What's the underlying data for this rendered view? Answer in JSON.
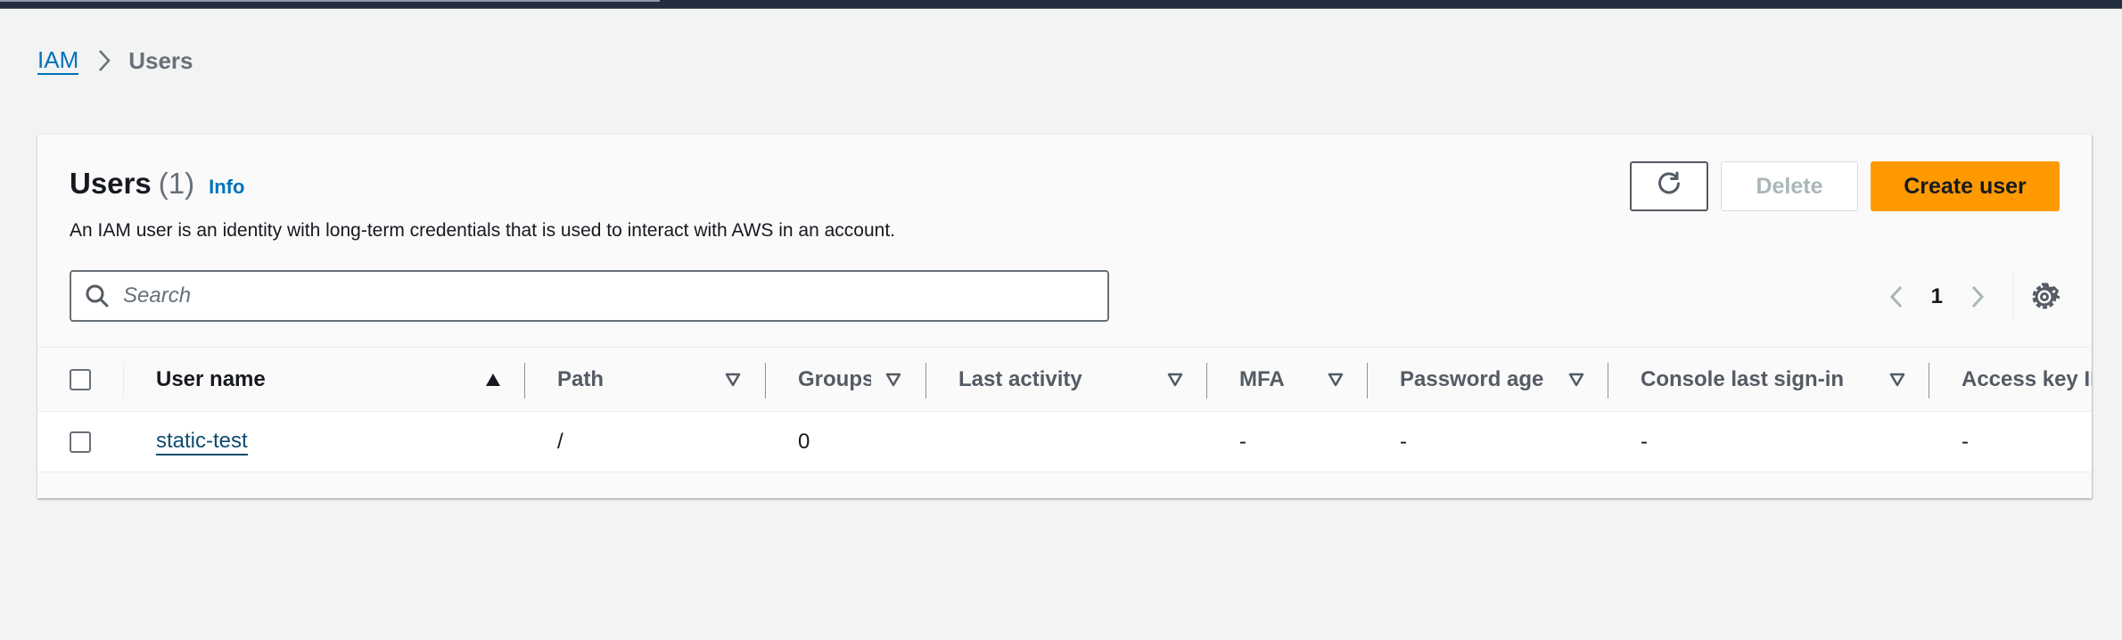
{
  "breadcrumb": {
    "root": "IAM",
    "current": "Users"
  },
  "panel": {
    "title": "Users",
    "count": "(1)",
    "info_label": "Info",
    "description": "An IAM user is an identity with long-term credentials that is used to interact with AWS in an account."
  },
  "actions": {
    "refresh_icon": "refresh-icon",
    "delete_label": "Delete",
    "create_label": "Create user"
  },
  "search": {
    "placeholder": "Search",
    "value": ""
  },
  "pagination": {
    "current_page": "1",
    "settings_icon": "gear-icon"
  },
  "table": {
    "columns": [
      {
        "label": "User name",
        "sort": "ascending"
      },
      {
        "label": "Path",
        "sort": "none"
      },
      {
        "label": "Groups",
        "sort": "none"
      },
      {
        "label": "Last activity",
        "sort": "none"
      },
      {
        "label": "MFA",
        "sort": "none"
      },
      {
        "label": "Password age",
        "sort": "none"
      },
      {
        "label": "Console last sign-in",
        "sort": "none"
      },
      {
        "label": "Access key ID",
        "sort": "none"
      }
    ],
    "rows": [
      {
        "user_name": "static-test",
        "path": "/",
        "groups": "0",
        "last_activity": "",
        "mfa": "-",
        "password_age": "-",
        "console_last_sign_in": "-",
        "access_key_id": "-"
      }
    ]
  },
  "colors": {
    "accent_link": "#0073bb",
    "primary_button": "#ff9900",
    "topbar": "#232f3e"
  }
}
